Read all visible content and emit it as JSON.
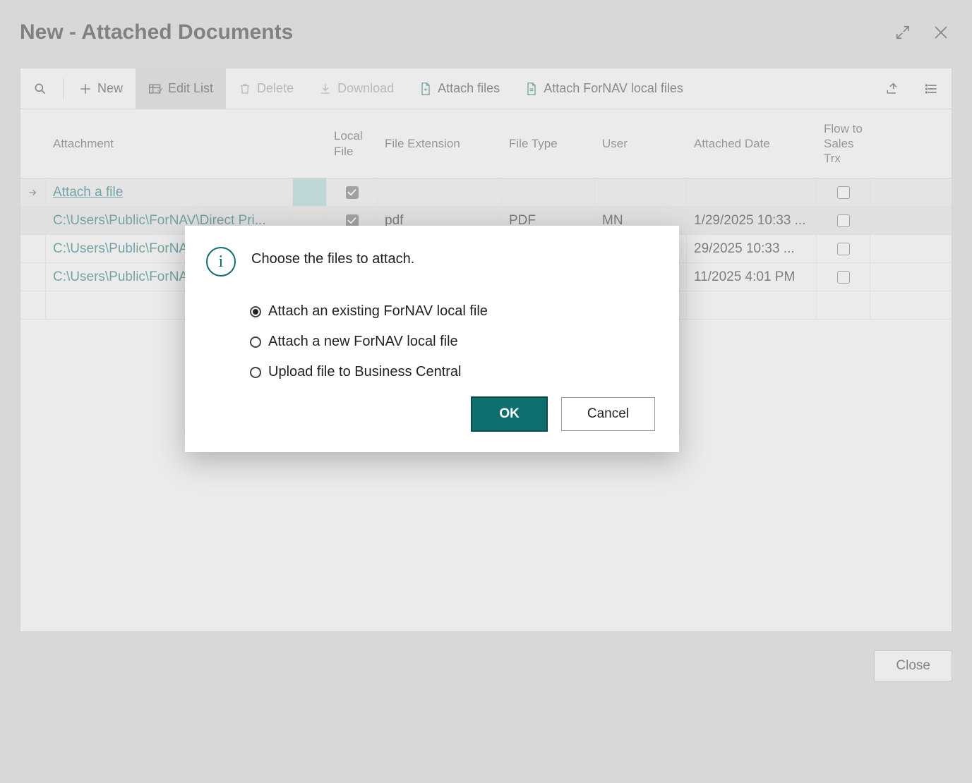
{
  "header": {
    "title": "New - Attached Documents"
  },
  "toolbar": {
    "new": "New",
    "edit_list": "Edit List",
    "delete": "Delete",
    "download": "Download",
    "attach_files": "Attach files",
    "attach_fornav": "Attach ForNAV local files"
  },
  "columns": {
    "attachment": "Attachment",
    "local_file": "Local File",
    "file_ext": "File Extension",
    "file_type": "File Type",
    "user": "User",
    "attached_date": "Attached Date",
    "flow": "Flow to Sales Trx"
  },
  "rows": [
    {
      "attachment": "Attach a file",
      "local_file": true,
      "ext": "",
      "type": "",
      "user": "",
      "date": "",
      "flow": false,
      "is_link": true,
      "is_action": true
    },
    {
      "attachment": "C:\\Users\\Public\\ForNAV\\Direct Pri...",
      "local_file": true,
      "ext": "pdf",
      "type": "PDF",
      "user": "MN",
      "date": "1/29/2025 10:33 ...",
      "flow": false,
      "is_link": true
    },
    {
      "attachment": "C:\\Users\\Public\\ForNA",
      "local_file": false,
      "ext": "",
      "type": "",
      "user": "",
      "date": "29/2025 10:33 ...",
      "flow": false,
      "is_link": true
    },
    {
      "attachment": "C:\\Users\\Public\\ForNA",
      "local_file": false,
      "ext": "",
      "type": "",
      "user": "",
      "date": "11/2025 4:01 PM",
      "flow": false,
      "is_link": true
    }
  ],
  "footer": {
    "close": "Close"
  },
  "modal": {
    "title": "Choose the files to attach.",
    "options": {
      "existing": "Attach an existing ForNAV local file",
      "new": "Attach a new ForNAV local file",
      "upload": "Upload file to Business Central"
    },
    "ok": "OK",
    "cancel": "Cancel",
    "selected": "existing"
  }
}
